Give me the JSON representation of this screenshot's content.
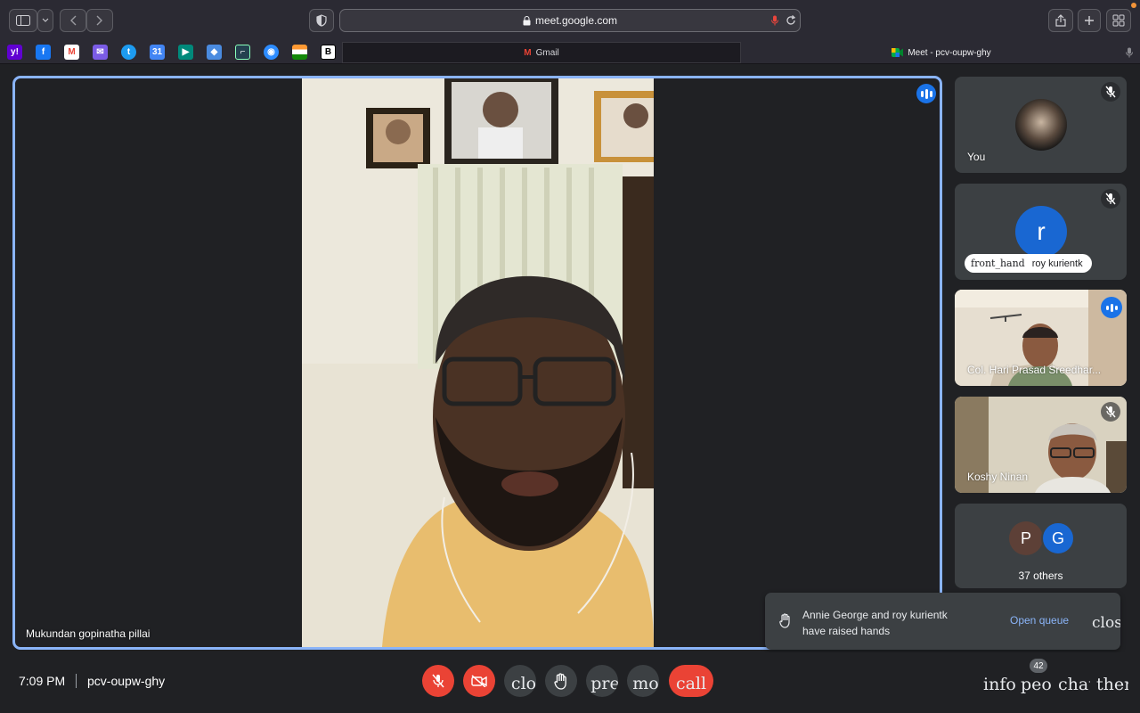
{
  "browser": {
    "url": "meet.google.com",
    "tabs": [
      {
        "label": "Gmail"
      },
      {
        "label": "Meet - pcv-oupw-ghy"
      }
    ],
    "bookmark_icons": [
      "yahoo-icon",
      "facebook-icon",
      "gmail-icon",
      "mail-icon",
      "twitter-icon",
      "calendar-icon",
      "meet-app-icon",
      "maps-icon",
      "chart-app-icon",
      "zoom-icon",
      "india-flag-icon",
      "bold-b-icon"
    ]
  },
  "main_video": {
    "participant_name": "Mukundan gopinatha pillai"
  },
  "participants": {
    "you": {
      "name": "You"
    },
    "roy": {
      "initial": "r",
      "name": "roy kurientk",
      "hand_icon_text": "front_hand"
    },
    "hari": {
      "name": "Col. Hari Prasad Sreedhar..."
    },
    "koshy": {
      "name": "Koshy Ninan"
    },
    "others": {
      "initials": [
        "P",
        "G"
      ],
      "label": "37 others"
    }
  },
  "raised_hands_toast": {
    "line1": "Annie George and roy kurientk",
    "line2": "have raised hands",
    "action": "Open queue",
    "close_text": "clos"
  },
  "bottom_bar": {
    "time": "7:09 PM",
    "meeting_code": "pcv-oupw-ghy",
    "controls": {
      "captions_text": "clo",
      "present_text": "pre",
      "more_text": "mo",
      "end_call_text": "call"
    },
    "right": {
      "info_text": "info",
      "people_text": "peo",
      "people_count": "42",
      "chat_text": "chat",
      "activities_text": "ther"
    }
  },
  "colors": {
    "accent_blue": "#8ab4f8",
    "speaking_blue": "#1a73e8",
    "danger_red": "#ea4335",
    "surface": "#3c4043",
    "background": "#202124"
  }
}
